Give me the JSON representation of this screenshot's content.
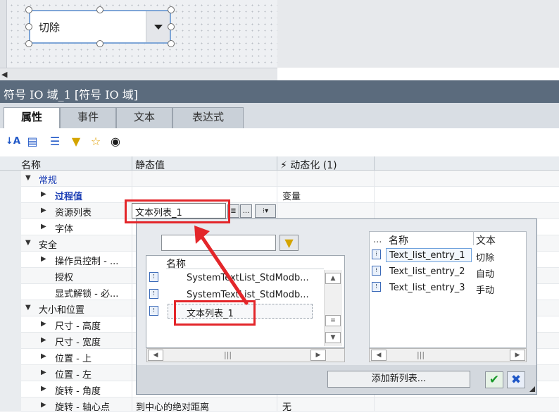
{
  "canvas": {
    "symbol_text": "切除"
  },
  "window_title": "符号 IO 域_1 [符号 IO 域]",
  "tabs": [
    {
      "label": "属性"
    },
    {
      "label": "事件"
    },
    {
      "label": "文本"
    },
    {
      "label": "表达式"
    }
  ],
  "grid": {
    "headers": {
      "name": "名称",
      "static": "静态值",
      "dynamic": "⚡ 动态化 (1)"
    },
    "rows": [
      {
        "name": "常规",
        "static": "",
        "dynamic": ""
      },
      {
        "name": "过程值",
        "static": "",
        "dynamic": "变量"
      },
      {
        "name": "资源列表",
        "static": "",
        "dynamic": ""
      },
      {
        "name": "字体",
        "static": "",
        "dynamic": ""
      },
      {
        "name": "安全",
        "static": "",
        "dynamic": ""
      },
      {
        "name": "操作员控制 - ...",
        "static": "",
        "dynamic": ""
      },
      {
        "name": "授权",
        "static": "",
        "dynamic": ""
      },
      {
        "name": "显式解锁 - 必...",
        "static": "",
        "dynamic": ""
      },
      {
        "name": "大小和位置",
        "static": "",
        "dynamic": ""
      },
      {
        "name": "尺寸 - 高度",
        "static": "",
        "dynamic": ""
      },
      {
        "name": "尺寸 - 宽度",
        "static": "",
        "dynamic": ""
      },
      {
        "name": "位置 - 上",
        "static": "",
        "dynamic": ""
      },
      {
        "name": "位置 - 左",
        "static": "",
        "dynamic": ""
      },
      {
        "name": "旋转 - 角度",
        "static": "",
        "dynamic": ""
      },
      {
        "name": "旋转 - 轴心点",
        "static": "到中心的绝对距离",
        "dynamic": "无"
      }
    ]
  },
  "resource_list": {
    "value": "文本列表_1",
    "more": "..."
  },
  "popup": {
    "left_header": "名称",
    "left_items": [
      "SystemTextList_StdModb...",
      "SystemTextList_StdModb...",
      "文本列表_1"
    ],
    "right_headers": {
      "dots": "...",
      "name": "名称",
      "text": "文本"
    },
    "right_items": [
      {
        "name": "Text_list_entry_1",
        "text": "切除"
      },
      {
        "name": "Text_list_entry_2",
        "text": "自动"
      },
      {
        "name": "Text_list_entry_3",
        "text": "手动"
      }
    ],
    "add_button": "添加新列表...",
    "ok_glyph": "✔",
    "cancel_glyph": "✖"
  }
}
